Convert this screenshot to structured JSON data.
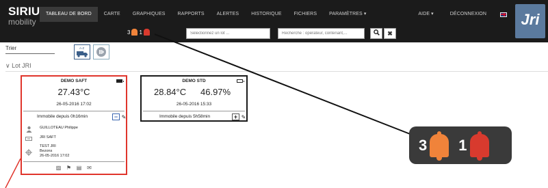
{
  "brand": {
    "name": "SIRIUS",
    "sub": "mobility",
    "partner_logo": "Jri"
  },
  "nav": {
    "items": [
      "TABLEAU DE BORD",
      "CARTE",
      "GRAPHIQUES",
      "RAPPORTS",
      "ALERTES",
      "HISTORIQUE",
      "FICHIERS",
      "PARAMÈTRES ▾"
    ],
    "right": [
      "AIDE ▾",
      "DÉCONNEXION"
    ]
  },
  "alarms": {
    "orange_count": "3",
    "red_count": "1"
  },
  "inputs": {
    "select_placeholder": "Sélectionnez un lot ...",
    "search_placeholder": "Recherche : opérateur, contenant,..."
  },
  "toolbar": {
    "sort_label": "Trier"
  },
  "group": {
    "title": "Lot JRI"
  },
  "cards": [
    {
      "title": "DEMO SAFT",
      "temperature": "27.43°C",
      "date": "26-05-2016 17:02",
      "status": "Immobile depuis 0h16min",
      "operator": "GUILLOTEAU Philippe",
      "container": "JRI SAFT",
      "location_name": "TEST JRI",
      "location_city": "Bezons",
      "location_date": "26-05-2016 17:02"
    },
    {
      "title": "DEMO STD",
      "temperature": "28.84°C",
      "humidity": "46.97%",
      "date": "26-05-2016 15:33",
      "status": "Immobile depuis 5h58min"
    }
  ],
  "colors": {
    "alert_red": "#e0342b",
    "alert_orange": "#f0833a",
    "navbar": "#1b1b1b",
    "callout_bg": "#3a3a3a"
  }
}
